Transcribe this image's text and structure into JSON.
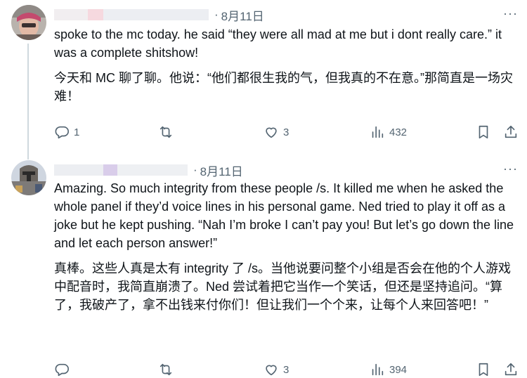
{
  "tweets": [
    {
      "date": "8月11日",
      "more": "···",
      "text_en": "spoke to the mc today. he said “they were all mad at me but i dont really care.” it was a complete shitshow!",
      "text_zh": "今天和 MC 聊了聊。他说：“他们都很生我的气，但我真的不在意。”那简直是一场灾难！",
      "reply_count": "1",
      "retweet_count": "",
      "like_count": "3",
      "view_count": "432"
    },
    {
      "date": "8月11日",
      "more": "···",
      "text_en": "Amazing. So much integrity from these people /s. It killed me when he asked the whole panel if they’d voice lines in his personal game. Ned tried to play it off as a joke but he kept pushing. “Nah I’m broke I can’t pay you! But let’s go down the line and let each person answer!”",
      "text_zh": "真棒。这些人真是太有 integrity 了 /s。当他说要问整个小组是否会在他的个人游戏中配音时，我简直崩溃了。Ned 尝试着把它当作一个笑话，但还是坚持追问。“算了，我破产了，拿不出钱来付你们！但让我们一个个来，让每个人来回答吧！”",
      "reply_count": "",
      "retweet_count": "",
      "like_count": "3",
      "view_count": "394"
    }
  ],
  "icons": {
    "reply": "reply-icon",
    "retweet": "retweet-icon",
    "like": "heart-icon",
    "views": "views-icon",
    "bookmark": "bookmark-icon",
    "share": "share-icon"
  },
  "colors": {
    "text": "#0f1419",
    "muted": "#536471",
    "thread_line": "#cfd9de"
  }
}
